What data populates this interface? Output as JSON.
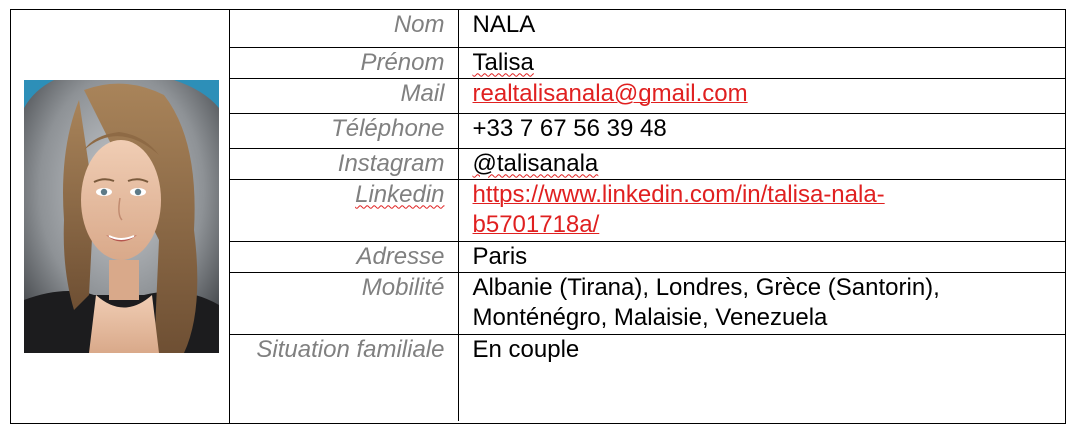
{
  "photo": {
    "icon": "portrait-photo"
  },
  "rows": [
    {
      "label": "Nom",
      "value": "NALA"
    },
    {
      "label": "Prénom",
      "value": "Talisa"
    },
    {
      "label": "Mail",
      "value": "realtalisanala@gmail.com"
    },
    {
      "label": "Téléphone",
      "value": "+33 7 67 56 39 48"
    },
    {
      "label": "Instagram",
      "value": "@talisanala"
    },
    {
      "label": "Linkedin",
      "value_line1": "https://www.linkedin.com/in/talisa-nala-",
      "value_line2": "b5701718a/"
    },
    {
      "label": "Adresse",
      "value": "Paris"
    },
    {
      "label": "Mobilité",
      "value_line1": "Albanie (Tirana), Londres, Grèce (Santorin),",
      "value_line2": "Monténégro, Malaisie, Venezuela"
    },
    {
      "label": "Situation familiale",
      "value": "En couple"
    }
  ],
  "colors": {
    "label": "#808080",
    "link": "#e02020",
    "border": "#000000"
  }
}
